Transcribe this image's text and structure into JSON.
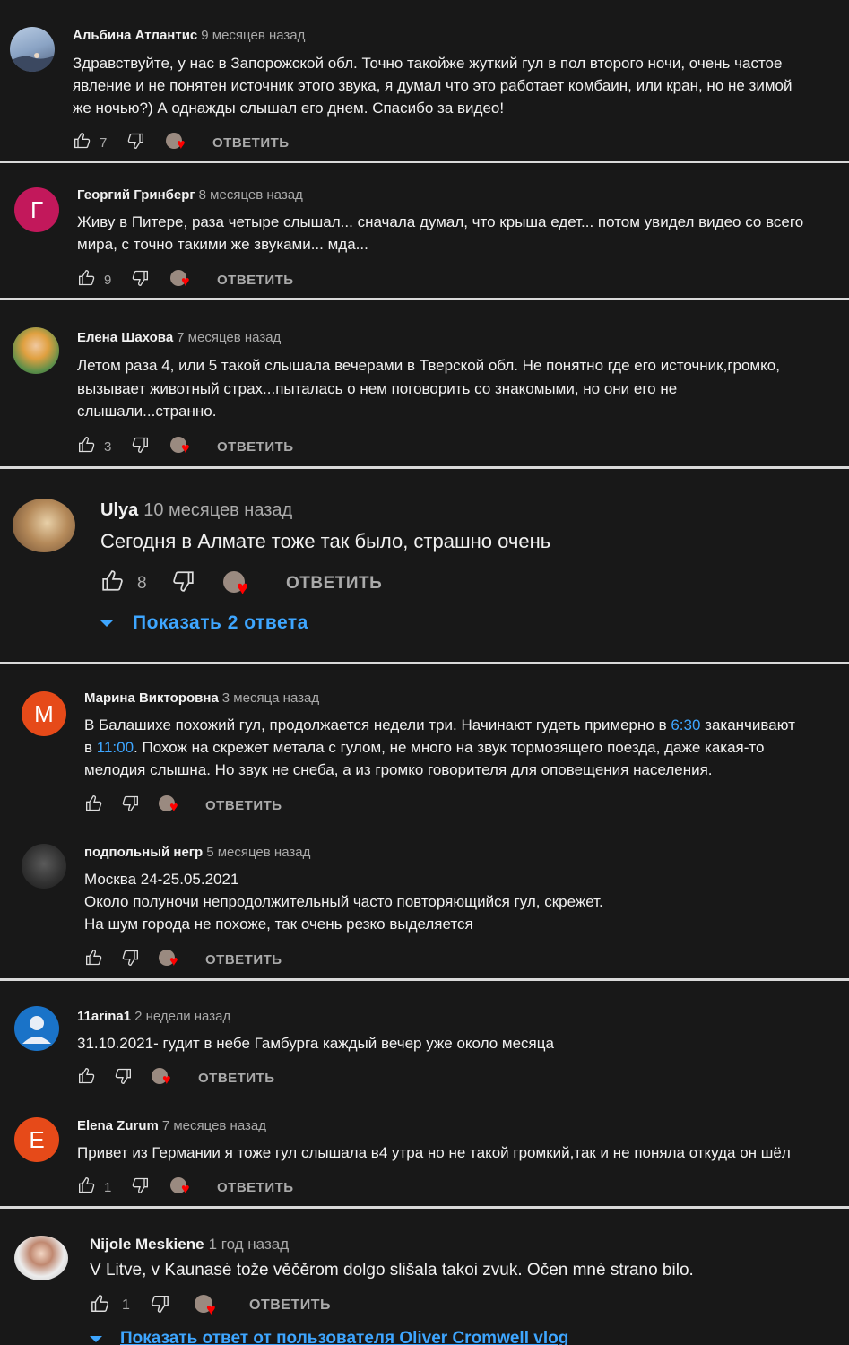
{
  "comments": [
    {
      "author": "Альбина Атлантис",
      "time": "9 месяцев назад",
      "lines": [
        "Здравствуйте, у нас в Запорожской обл. Точно такойже жуткий гул в пол второго ночи, очень частое",
        "явление и не понятен источник этого звука, я думал что это работает комбаин, или кран, но не зимой",
        "же ночью?) А однажды слышал его днем. Спасибо за видео!"
      ],
      "likes": "7",
      "reply_label": "ОТВЕТИТЬ",
      "avatar": {
        "type": "photo",
        "colors": [
          "#9fb5cf",
          "#5d6f8a"
        ]
      }
    },
    {
      "author": "Георгий Гринберг",
      "time": "8 месяцев назад",
      "lines": [
        "Живу в Питере, раза четыре слышал... сначала думал, что крыша едет... потом увидел видео со всего",
        "мира, с точно такими же звуками... мда..."
      ],
      "likes": "9",
      "reply_label": "ОТВЕТИТЬ",
      "avatar": {
        "type": "letter",
        "letter": "Г",
        "color": "#c2185b"
      }
    },
    {
      "author": "Елена Шахова",
      "time": "7 месяцев назад",
      "lines": [
        "Летом раза 4, или 5 такой слышала вечерами в Тверской обл. Не понятно где его источник,громко,",
        "вызывает животный страх...пыталась о нем поговорить со знакомыми, но они   его не",
        "слышали...странно."
      ],
      "likes": "3",
      "reply_label": "ОТВЕТИТЬ",
      "avatar": {
        "type": "photo",
        "colors": [
          "#7fae6a",
          "#d8a23c"
        ]
      }
    },
    {
      "author": "Ulya",
      "time": "10 месяцев назад",
      "lines": [
        "Сегодня в Алмате тоже так было, страшно очень"
      ],
      "likes": "8",
      "reply_label": "ОТВЕТИТЬ",
      "show_replies": "Показать 2 ответа",
      "avatar": {
        "type": "photo",
        "colors": [
          "#c9a77a",
          "#7a5a3a"
        ]
      }
    },
    {
      "author": "Марина Викторовна",
      "time": "3 месяца назад",
      "line1_pre": "В Балашихе похожий гул, продолжается недели три. Начинают гудеть примерно в ",
      "link1": "6:30",
      "line1_post": " заканчивают",
      "line2_pre": "в ",
      "link2": "11:00",
      "line2_post": ". Похож на скрежет метала с гулом, не много на звук тормозящего поезда, даже какая-то",
      "line3": "мелодия слышна. Но звук не снеба, а из громко говорителя для оповещения населения.",
      "likes": "",
      "reply_label": "ОТВЕТИТЬ",
      "avatar": {
        "type": "letter",
        "letter": "М",
        "color": "#e64a19"
      }
    },
    {
      "author": "подпольный негр",
      "time": "5 месяцев назад",
      "lines": [
        "Москва 24-25.05.2021",
        "Около полуночи непродолжительный часто повторяющийся гул, скрежет.",
        "На шум города не похоже, так очень резко выделяется"
      ],
      "likes": "",
      "reply_label": "ОТВЕТИТЬ",
      "avatar": {
        "type": "photo",
        "colors": [
          "#4a4a4a",
          "#2a2a2a"
        ]
      }
    },
    {
      "author": "11arina1",
      "time": "2 недели назад",
      "lines": [
        "31.10.2021- гудит в небе Гамбурга каждый вечер уже около  месяца"
      ],
      "likes": "",
      "reply_label": "ОТВЕТИТЬ",
      "avatar": {
        "type": "default",
        "color": "#1a73c8"
      }
    },
    {
      "author": "Elena Zurum",
      "time": "7 месяцев назад",
      "lines": [
        "Привет из Германии я тоже гул слышала в4 утра но не такой громкий,так и не поняла откуда он шёл"
      ],
      "likes": "1",
      "reply_label": "ОТВЕТИТЬ",
      "avatar": {
        "type": "letter",
        "letter": "E",
        "color": "#e64a19"
      }
    },
    {
      "author": "Nijole Meskiene",
      "time": "1 год назад",
      "lines": [
        "V Litve, v Kaunasė tože věčěrom  dolgo slišala takoi zvuk. Očen mnė strano bilo."
      ],
      "likes": "1",
      "reply_label": "ОТВЕТИТЬ",
      "show_replies": "Показать ответ от пользователя Oliver Cromwell vlog",
      "avatar": {
        "type": "photo",
        "colors": [
          "#e8e8e8",
          "#6a2a2a"
        ]
      }
    }
  ]
}
